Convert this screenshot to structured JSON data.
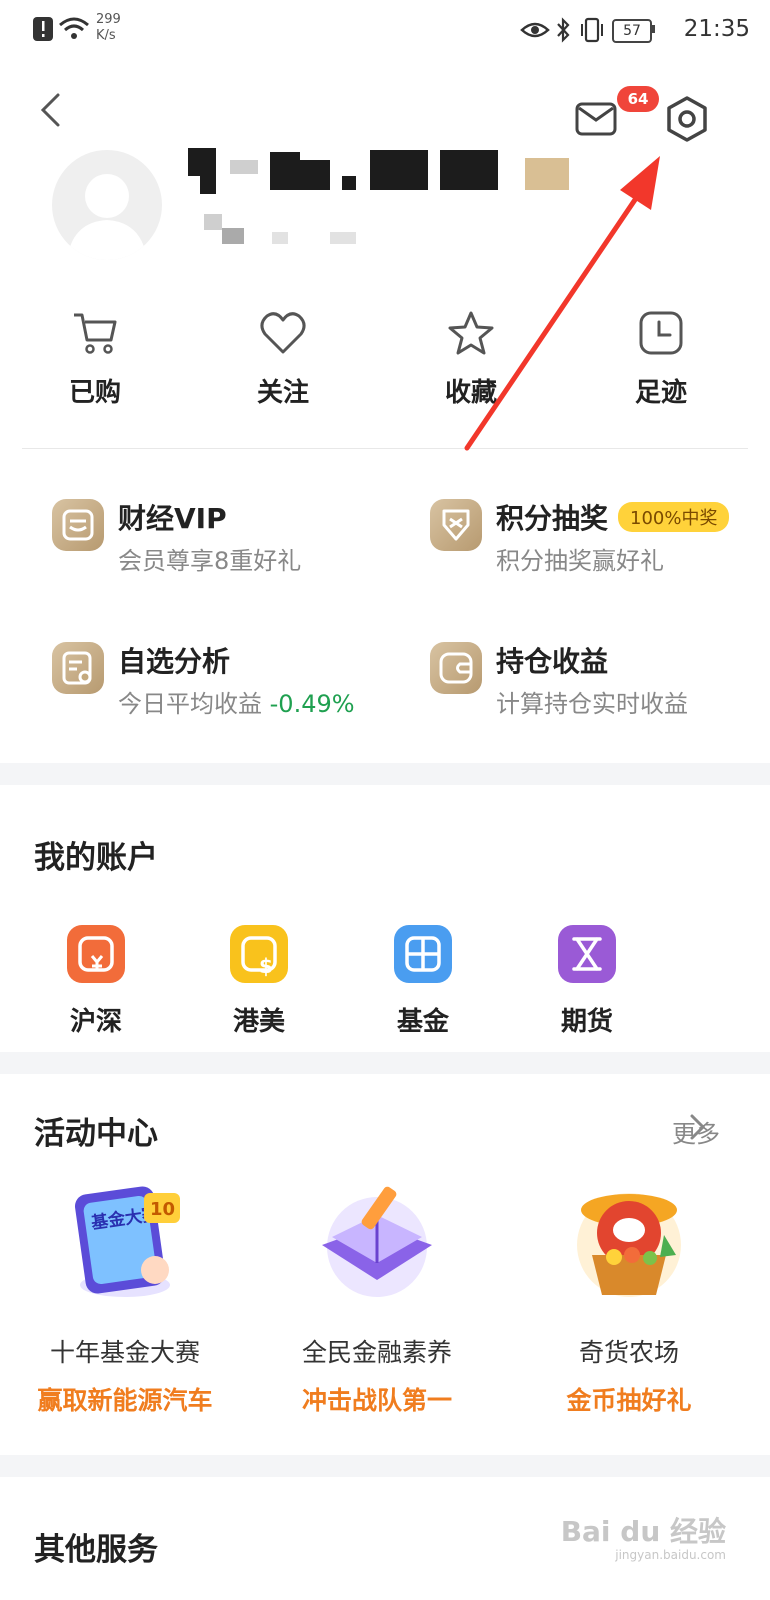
{
  "status_bar": {
    "speed_value": "299",
    "speed_unit": "K/s",
    "battery": "57",
    "time": "21:35"
  },
  "header": {
    "message_badge": "64"
  },
  "quick_actions": [
    {
      "label": "已购",
      "icon": "cart-icon"
    },
    {
      "label": "关注",
      "icon": "heart-icon"
    },
    {
      "label": "收藏",
      "icon": "star-icon"
    },
    {
      "label": "足迹",
      "icon": "clock-icon"
    }
  ],
  "features": [
    {
      "title": "财经VIP",
      "subtitle": "会员尊享8重好礼"
    },
    {
      "title": "积分抽奖",
      "tag": "100%中奖",
      "subtitle": "积分抽奖赢好礼"
    },
    {
      "title": "自选分析",
      "subtitle": "今日平均收益",
      "value": "-0.49%"
    },
    {
      "title": "持仓收益",
      "subtitle": "计算持仓实时收益"
    }
  ],
  "accounts": {
    "title": "我的账户",
    "items": [
      {
        "label": "沪深",
        "color": "#f26c3a"
      },
      {
        "label": "港美",
        "color": "#f9c21c"
      },
      {
        "label": "基金",
        "color": "#4a9df0"
      },
      {
        "label": "期货",
        "color": "#9a5ad6"
      }
    ]
  },
  "activities": {
    "title": "活动中心",
    "more": "更多",
    "items": [
      {
        "name": "十年基金大赛",
        "desc": "赢取新能源汽车",
        "art_text": "基金大赛",
        "art_number": "10"
      },
      {
        "name": "全民金融素养",
        "desc": "冲击战队第一"
      },
      {
        "name": "奇货农场",
        "desc": "金币抽好礼"
      }
    ]
  },
  "other_services": {
    "title": "其他服务"
  },
  "watermark": {
    "brand": "Bai du 经验",
    "url": "jingyan.baidu.com"
  },
  "colors": {
    "accent_orange": "#f07d1f",
    "green": "#1fa050",
    "arrow_red": "#f2372b"
  }
}
